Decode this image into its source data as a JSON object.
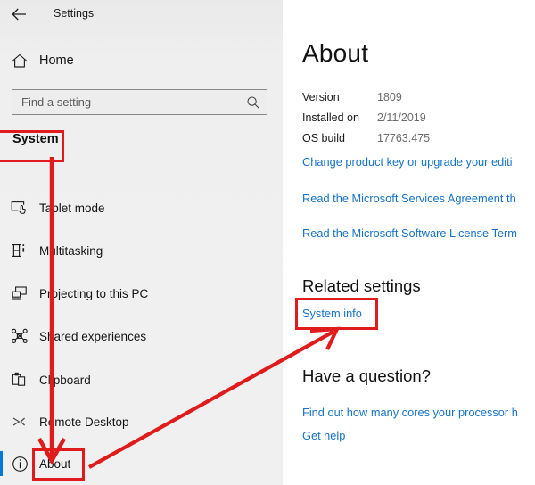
{
  "window": {
    "title": "Settings",
    "back_icon": "back-arrow-icon"
  },
  "sidebar": {
    "home": {
      "label": "Home",
      "icon": "home-icon"
    },
    "search": {
      "placeholder": "Find a setting",
      "value": "",
      "icon": "search-icon"
    },
    "group_title": "System",
    "items": [
      {
        "label": "Tablet mode",
        "icon": "tablet-mode-icon",
        "selected": false
      },
      {
        "label": "Multitasking",
        "icon": "multitasking-icon",
        "selected": false
      },
      {
        "label": "Projecting to this PC",
        "icon": "projecting-icon",
        "selected": false
      },
      {
        "label": "Shared experiences",
        "icon": "shared-experiences-icon",
        "selected": false
      },
      {
        "label": "Clipboard",
        "icon": "clipboard-icon",
        "selected": false
      },
      {
        "label": "Remote Desktop",
        "icon": "remote-desktop-icon",
        "selected": false
      },
      {
        "label": "About",
        "icon": "info-circle-icon",
        "selected": true
      }
    ]
  },
  "content": {
    "title": "About",
    "specs": [
      {
        "key": "Version",
        "value": "1809"
      },
      {
        "key": "Installed on",
        "value": "2/11/2019"
      },
      {
        "key": "OS build",
        "value": "17763.475"
      }
    ],
    "links": [
      "Change product key or upgrade your editi",
      "Read the Microsoft Services Agreement th",
      "Read the Microsoft Software License Term"
    ],
    "related_settings": {
      "heading": "Related settings",
      "link": "System info"
    },
    "question": {
      "heading": "Have a question?",
      "links": [
        "Find out how many cores your processor h",
        "Get help"
      ]
    }
  },
  "annotations": {
    "accent_color": "#e01b1b",
    "highlights": [
      {
        "name": "system-group-highlight",
        "label": "System"
      },
      {
        "name": "about-nav-highlight",
        "label": "About"
      },
      {
        "name": "system-info-link-highlight",
        "label": "System info"
      }
    ],
    "arrows": [
      {
        "name": "system-to-about-arrow",
        "from": "System",
        "to": "About"
      },
      {
        "name": "about-to-system-info-arrow",
        "from": "About",
        "to": "System info"
      }
    ]
  },
  "colors": {
    "link": "#1673c6",
    "selection": "#0078d7",
    "sidebar_bg": "#efefef",
    "content_bg": "#ffffff"
  }
}
